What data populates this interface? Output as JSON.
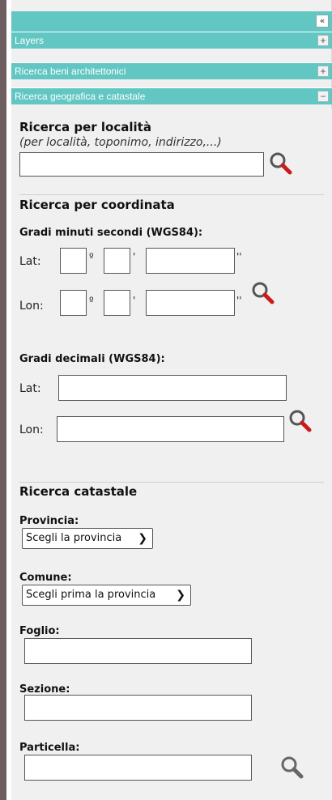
{
  "topbar": {
    "collapse_label": "«"
  },
  "accordion": [
    {
      "label": "Layers",
      "toggle": "+"
    },
    {
      "label": "Ricerca beni architettonici",
      "toggle": "+"
    },
    {
      "label": "Ricerca geografica e catastale",
      "toggle": "−"
    }
  ],
  "localita": {
    "title": "Ricerca per località",
    "subtitle": "(per località, toponimo, indirizzo,...)",
    "value": ""
  },
  "coordinate": {
    "title": "Ricerca per coordinata",
    "dms_title": "Gradi minuti secondi (WGS84):",
    "lat_label": "Lat:",
    "lon_label": "Lon:",
    "deg_mark": "º",
    "min_mark": "'",
    "sec_mark": "''",
    "dec_title": "Gradi decimali (WGS84):"
  },
  "catasto": {
    "title": "Ricerca catastale",
    "provincia_label": "Provincia:",
    "provincia_selected": "Scegli la provincia",
    "comune_label": "Comune:",
    "comune_selected": "Scegli prima la provincia",
    "foglio_label": "Foglio:",
    "sezione_label": "Sezione:",
    "particella_label": "Particella:"
  },
  "colors": {
    "accent": "#62c6c3",
    "panel": "#f0f0f0",
    "left_bar": "#6d5f5f",
    "search_lens": "#cc1a1a"
  }
}
